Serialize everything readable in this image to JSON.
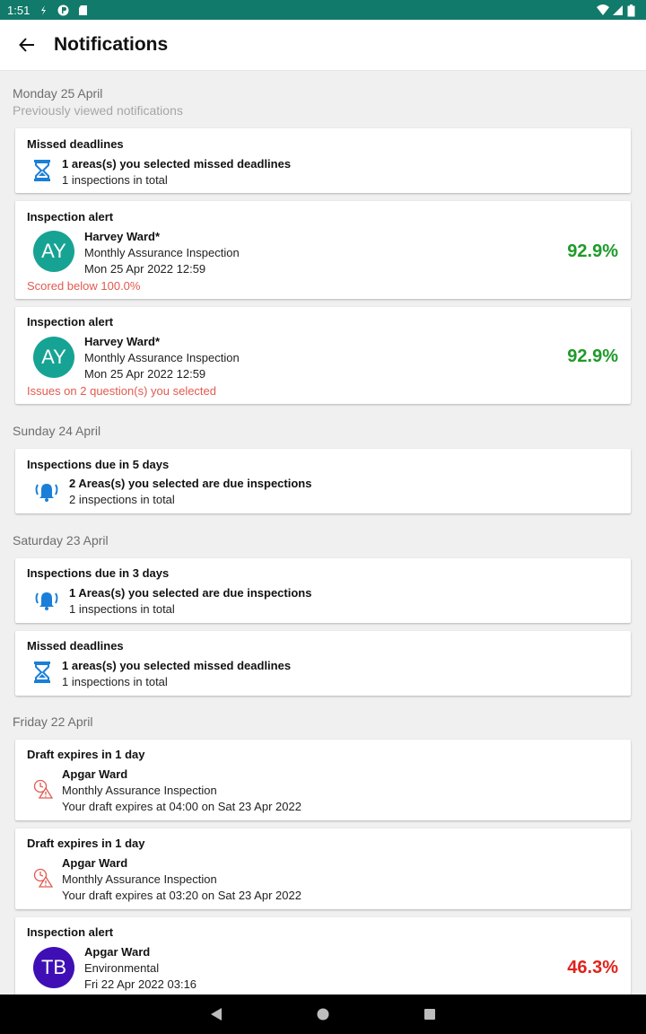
{
  "status_bar": {
    "time": "1:51"
  },
  "app_bar": {
    "title": "Notifications"
  },
  "groups": [
    {
      "date": "Monday 25 April",
      "subtitle": "Previously viewed notifications"
    },
    {
      "date": "Sunday 24 April"
    },
    {
      "date": "Saturday 23 April"
    },
    {
      "date": "Friday 22 April"
    }
  ],
  "cards": [
    {
      "title": "Missed deadlines",
      "icon": "hourglass-icon",
      "line1": "1 areas(s) you selected missed deadlines",
      "line2": "1 inspections in total"
    },
    {
      "title": "Inspection alert",
      "avatar": "AY",
      "avatar_color": "#16a394",
      "ward": "Harvey Ward*",
      "inspection": "Monthly Assurance Inspection",
      "datetime": "Mon 25 Apr 2022 12:59",
      "score": "92.9%",
      "score_color": "#1f9a2a",
      "note": "Scored below 100.0%"
    },
    {
      "title": "Inspection alert",
      "avatar": "AY",
      "avatar_color": "#16a394",
      "ward": "Harvey Ward*",
      "inspection": "Monthly Assurance Inspection",
      "datetime": "Mon 25 Apr 2022 12:59",
      "score": "92.9%",
      "score_color": "#1f9a2a",
      "note": "Issues on 2 question(s) you selected"
    },
    {
      "title": "Inspections due in 5 days",
      "icon": "bell-ringing-icon",
      "line1": "2 Areas(s) you selected are due inspections",
      "line2": "2 inspections in total"
    },
    {
      "title": "Inspections due in 3 days",
      "icon": "bell-ringing-icon",
      "line1": "1 Areas(s) you selected are due inspections",
      "line2": "1 inspections in total"
    },
    {
      "title": "Missed deadlines",
      "icon": "hourglass-icon",
      "line1": "1 areas(s) you selected missed deadlines",
      "line2": "1 inspections in total"
    },
    {
      "title": "Draft expires in 1 day",
      "icon": "draft-warning-icon",
      "line1": "Apgar Ward",
      "line2": "Monthly Assurance Inspection",
      "line3": "Your draft expires at 04:00 on Sat 23 Apr 2022"
    },
    {
      "title": "Draft expires in 1 day",
      "icon": "draft-warning-icon",
      "line1": "Apgar Ward",
      "line2": "Monthly Assurance Inspection",
      "line3": "Your draft expires at 03:20 on Sat 23 Apr 2022"
    },
    {
      "title": "Inspection alert",
      "avatar": "TB",
      "avatar_color": "#3f0fb5",
      "ward": "Apgar Ward",
      "inspection": "Environmental",
      "datetime": "Fri 22 Apr 2022 03:16",
      "score": "46.3%",
      "score_color": "#e0211b"
    }
  ],
  "colors": {
    "status_bar": "#127a6a",
    "icon_blue": "#1a7fd8",
    "warning_red": "#e25a4f"
  }
}
